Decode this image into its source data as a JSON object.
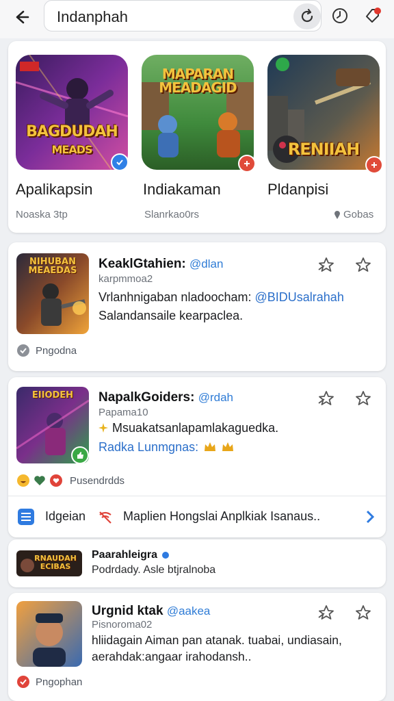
{
  "search": {
    "query": "Indanphah"
  },
  "featured": [
    {
      "art_line1": "BAGDUDAH",
      "art_line2": "MEADS",
      "name": "Apalikapsin",
      "sub": "Noaska 3tp",
      "color_a": "#5a2a8a",
      "color_b": "#d0419e",
      "badge_color": "#2f80e6",
      "badge_icon": "verified-icon"
    },
    {
      "art_line1": "MAPARAN",
      "art_line2": "MEADAGID",
      "name": "Indiakaman",
      "sub": "Slanrkao0rs",
      "color_a": "#2f8b3a",
      "color_b": "#d9a441",
      "badge_color": "#e04b3a",
      "badge_icon": "plus-icon"
    },
    {
      "art_line1": "RENIIAH",
      "art_line2": "",
      "name": "Pldanpisi",
      "sub": "Gobas",
      "color_a": "#2a4f6e",
      "color_b": "#c26a2c",
      "badge_color": "#e04b3a",
      "badge_icon": "plus-icon"
    }
  ],
  "posts": [
    {
      "thumb_text": "NIHUBAN MEAEDAS",
      "title": "KeaklGtahien:",
      "handle": "@dlan",
      "meta": "karpmmoa2",
      "line1_text": "Vrlanhnigaban nladoocham: ",
      "line1_link": "@BIDUsalrahah",
      "line2": "Salandansaile kearpaclea.",
      "footer": "Pngodna"
    },
    {
      "thumb_text": "EIIODEH",
      "title": "NapalkGoiders:",
      "handle": "@rdah",
      "meta": "Papama10",
      "line1_text": "Msuakatsanlapamlakaguedka.",
      "line2": "Radka Lunmgnas:",
      "reactions": "Pusendrdds"
    }
  ],
  "banner": {
    "text": "Idgeian",
    "marquee": "Maplien Hongslai Anplkiak Isanaus.."
  },
  "compact": {
    "thumb_text": "RNAUDAH ECIBAS",
    "title": "Paarahleigra",
    "sub": "Podrdady. Asle btjralnoba"
  },
  "post3": {
    "title": "Urgnid ktak",
    "handle": "@aakea",
    "meta": "Pisnoroma02",
    "line1": "hliidagain Aiman pan atanak. tuabai, undiasain,",
    "line2": "aerahdak:angaar irahodansh..",
    "footer": "Pngophan"
  }
}
